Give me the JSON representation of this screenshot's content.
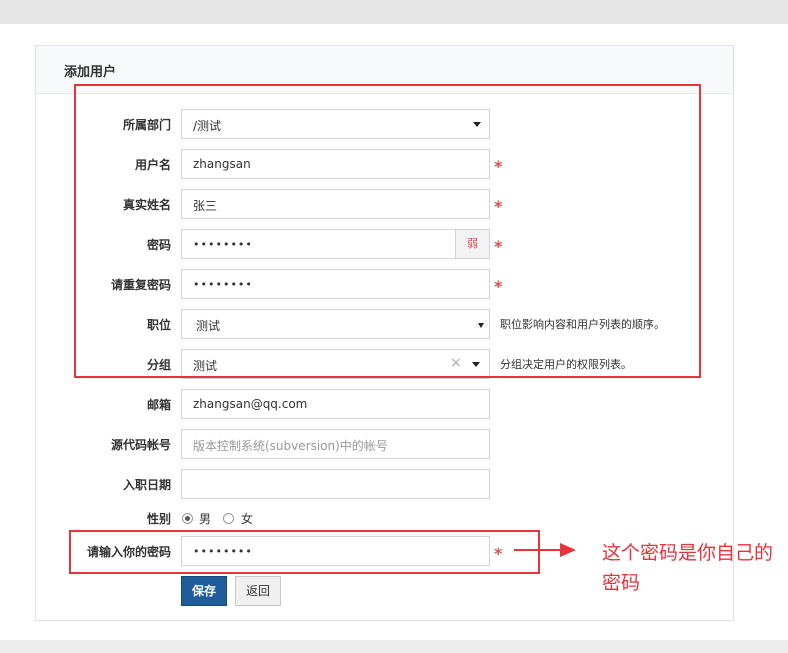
{
  "panel": {
    "title": "添加用户"
  },
  "form": {
    "dept": {
      "label": "所属部门",
      "value": "/测试"
    },
    "username": {
      "label": "用户名",
      "value": "zhangsan",
      "required": "*"
    },
    "realname": {
      "label": "真实姓名",
      "value": "张三",
      "required": "*"
    },
    "password": {
      "label": "密码",
      "value": "••••••••",
      "strength": "弱",
      "required": "*"
    },
    "password2": {
      "label": "请重复密码",
      "value": "••••••••",
      "required": "*"
    },
    "role": {
      "label": "职位",
      "value": "测试",
      "help": "职位影响内容和用户列表的顺序。"
    },
    "group": {
      "label": "分组",
      "value": "测试",
      "clear": "×",
      "help": "分组决定用户的权限列表。"
    },
    "email": {
      "label": "邮箱",
      "value": "zhangsan@qq.com"
    },
    "commiter": {
      "label": "源代码帐号",
      "placeholder": "版本控制系统(subversion)中的帐号"
    },
    "join": {
      "label": "入职日期",
      "value": ""
    },
    "gender": {
      "label": "性别",
      "options": [
        "男",
        "女"
      ],
      "selected": "男"
    },
    "verify": {
      "label": "请输入你的密码",
      "value": "••••••••",
      "required": "*"
    }
  },
  "buttons": {
    "save": "保存",
    "back": "返回"
  },
  "annotation": {
    "note": "这个密码是你自己的密码",
    "color": "#e8323c"
  },
  "colors": {
    "primary": "#1f5d9a",
    "required": "#d9534f"
  }
}
